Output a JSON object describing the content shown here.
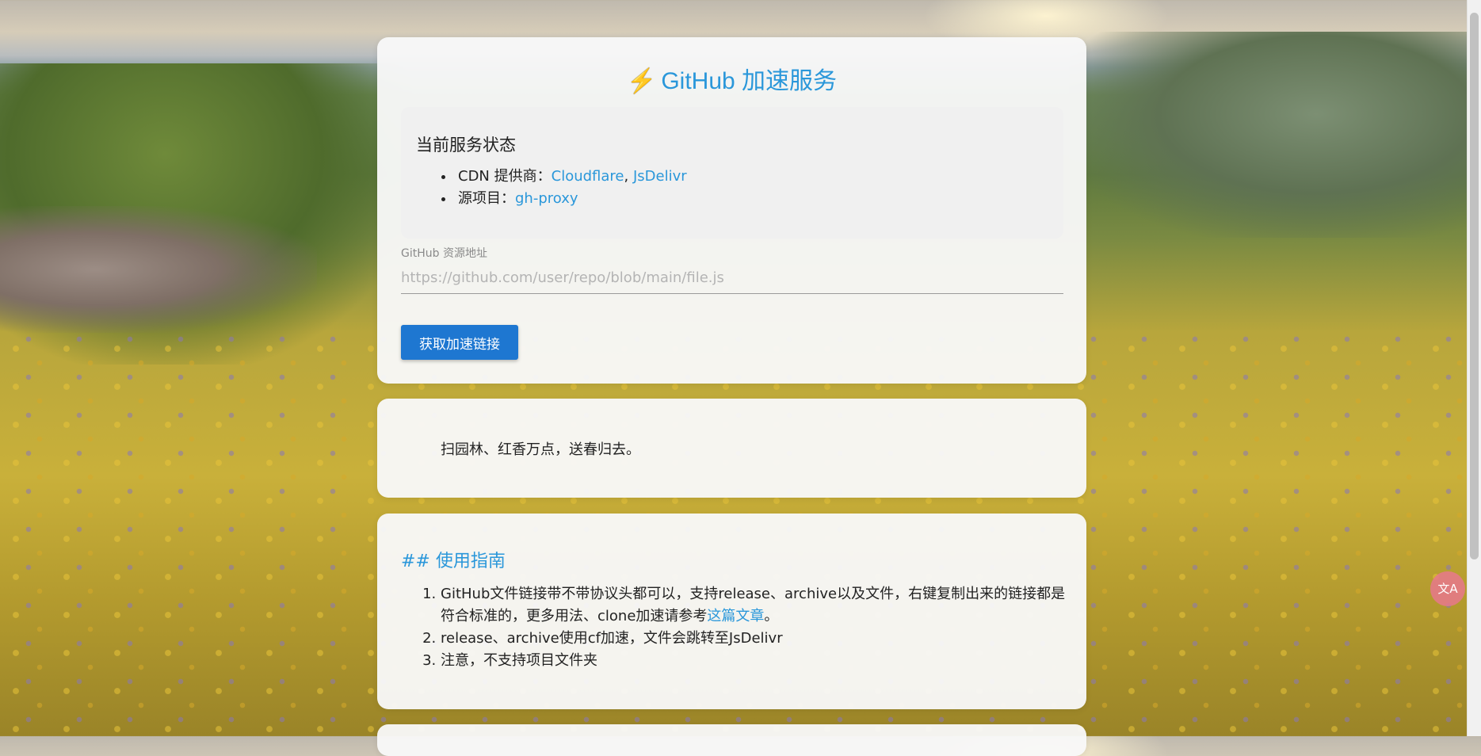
{
  "header": {
    "title": "GitHub 加速服务",
    "bolt_icon": "⚡"
  },
  "status": {
    "heading": "当前服务状态",
    "cdn_label": "CDN 提供商：",
    "cdn_links": [
      "Cloudflare",
      "JsDelivr"
    ],
    "cdn_separator": ", ",
    "source_label": "源项目：",
    "source_link": "gh-proxy"
  },
  "form": {
    "label": "GitHub 资源地址",
    "placeholder": "https://github.com/user/repo/blob/main/file.js",
    "value": "",
    "submit_label": "获取加速链接"
  },
  "quote": {
    "text": "扫园林、红香万点，送春归去。"
  },
  "guide": {
    "heading": "## 使用指南",
    "items": [
      {
        "text": "GitHub文件链接带不带协议头都可以，支持release、archive以及文件，右键复制出来的链接都是符合标准的，更多用法、clone加速请参考",
        "link": "这篇文章",
        "suffix": "。"
      },
      {
        "text": "release、archive使用cf加速，文件会跳转至JsDelivr"
      },
      {
        "text": "注意，不支持项目文件夹"
      }
    ]
  },
  "translate_badge": {
    "label": "文A"
  },
  "colors": {
    "accent": "#2a97da",
    "button": "#1e77d1",
    "card_bg": "#f8f8f8"
  }
}
